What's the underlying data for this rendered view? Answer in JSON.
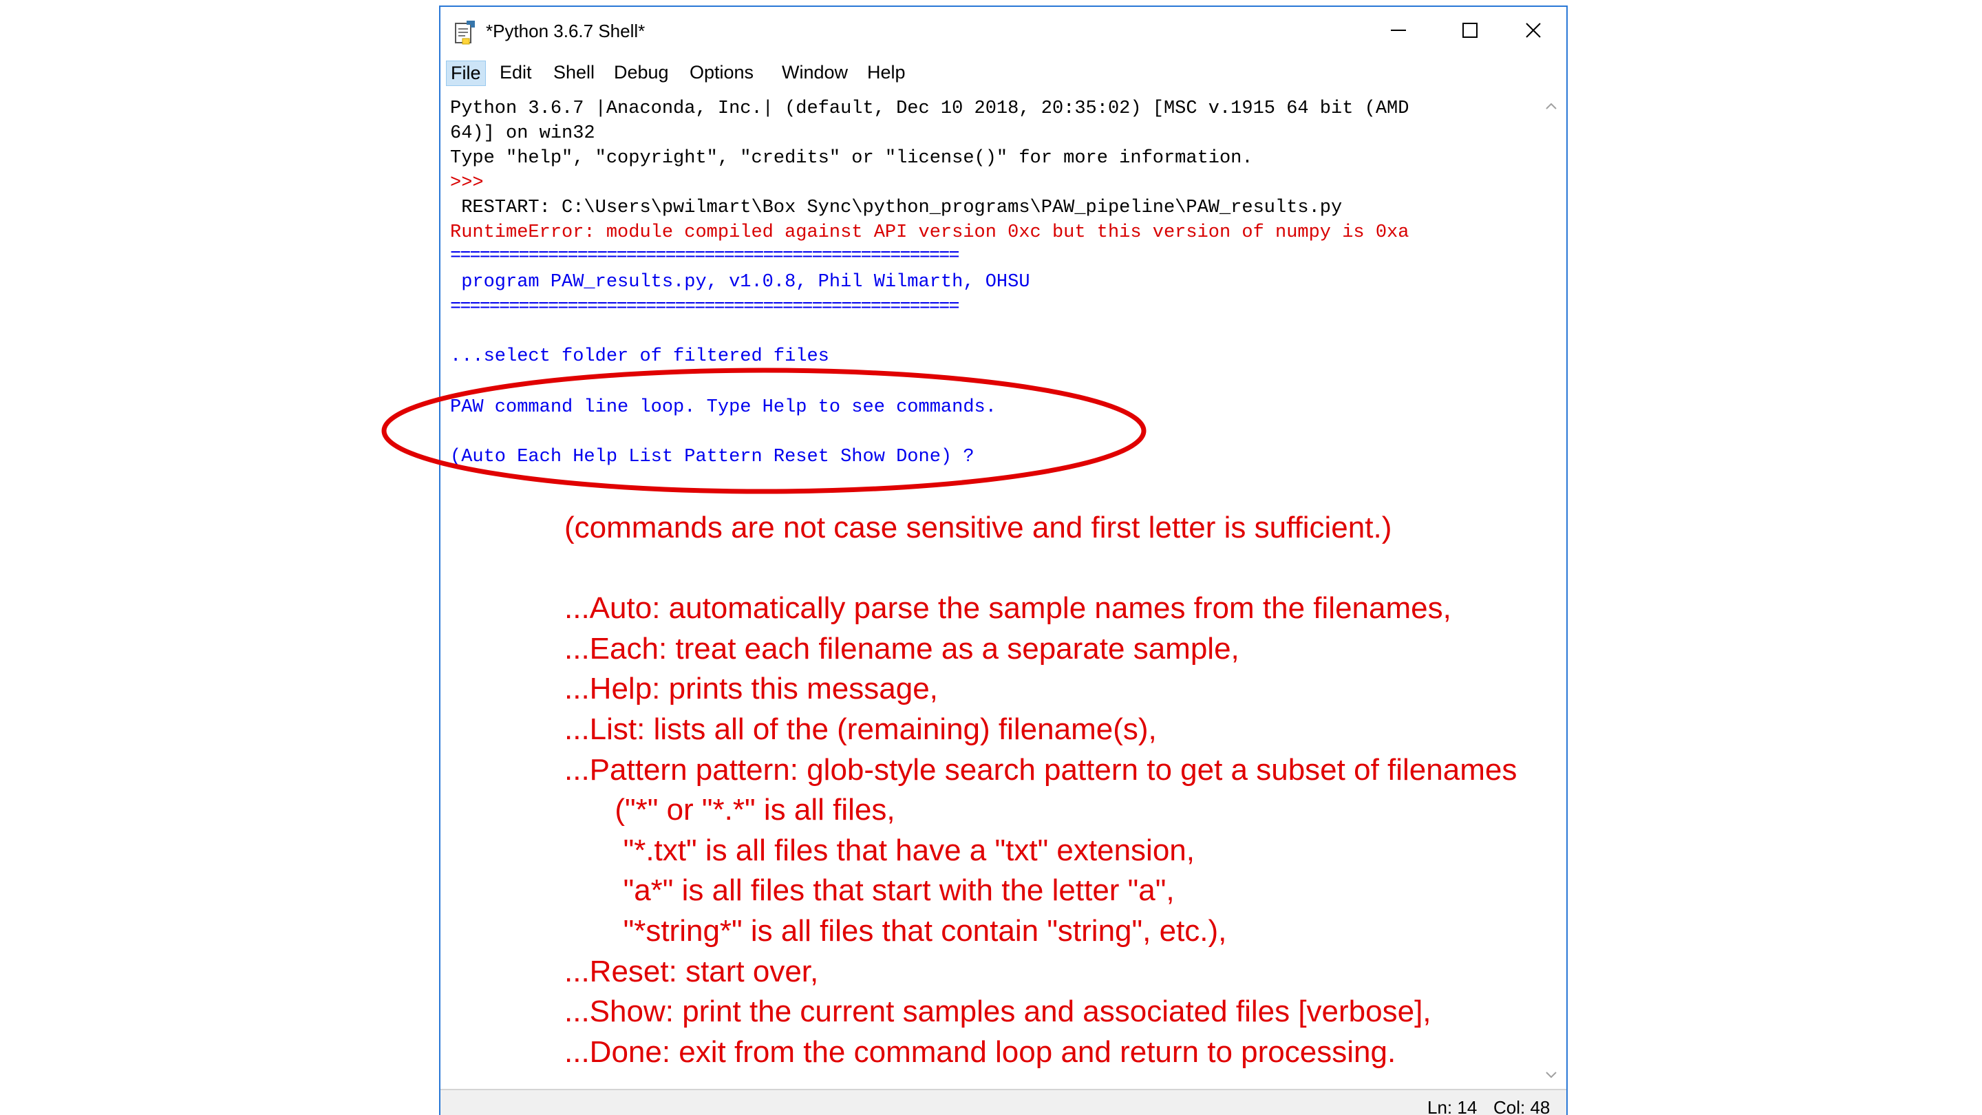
{
  "window": {
    "title": "*Python 3.6.7 Shell*",
    "controls": {
      "minimize_icon": "minimize-icon",
      "maximize_icon": "maximize-icon",
      "close_icon": "close-icon"
    }
  },
  "menu": {
    "items": [
      {
        "label": "File",
        "active": true
      },
      {
        "label": "Edit"
      },
      {
        "label": "Shell"
      },
      {
        "label": "Debug"
      },
      {
        "label": "Options"
      },
      {
        "label": "Window"
      },
      {
        "label": "Help"
      }
    ]
  },
  "shell": {
    "lines": [
      {
        "text": "Python 3.6.7 |Anaconda, Inc.| (default, Dec 10 2018, 20:35:02) [MSC v.1915 64 bit (AMD",
        "color": "black"
      },
      {
        "text": "64)] on win32",
        "color": "black"
      },
      {
        "text": "Type \"help\", \"copyright\", \"credits\" or \"license()\" for more information.",
        "color": "black"
      },
      {
        "text": ">>>",
        "color": "red"
      },
      {
        "text": " RESTART: C:\\Users\\pwilmart\\Box Sync\\python_programs\\PAW_pipeline\\PAW_results.py",
        "color": "black"
      },
      {
        "text": "RuntimeError: module compiled against API version 0xc but this version of numpy is 0xa",
        "color": "red"
      },
      {
        "text": "====================================================",
        "color": "sep"
      },
      {
        "text": " program PAW_results.py, v1.0.8, Phil Wilmarth, OHSU",
        "color": "blue"
      },
      {
        "text": "====================================================",
        "color": "sep"
      },
      {
        "text": "",
        "color": "blue"
      },
      {
        "text": "...select folder of filtered files",
        "color": "blue"
      },
      {
        "text": "",
        "color": "blue"
      },
      {
        "text": "PAW command line loop. Type Help to see commands.",
        "color": "blue"
      },
      {
        "text": "",
        "color": "blue"
      },
      {
        "text": "(Auto Each Help List Pattern Reset Show Done) ?",
        "color": "blue"
      }
    ]
  },
  "status": {
    "ln": "Ln: 14",
    "col": "Col: 48"
  },
  "annotation": {
    "ellipse_color": "#e00000",
    "lines": [
      "(commands are not case sensitive and first letter is sufficient.)",
      "",
      "...Auto: automatically parse the sample names from the filenames,",
      "...Each: treat each filename as a separate sample,",
      "...Help: prints this message,",
      "...List: lists all of the (remaining) filename(s),",
      "...Pattern pattern: glob-style search pattern to get a subset of filenames",
      "      (\"*\" or \"*.*\" is all files,",
      "       \"*.txt\" is all files that have a \"txt\" extension,",
      "       \"a*\" is all files that start with the letter \"a\",",
      "       \"*string*\" is all files that contain \"string\", etc.),",
      "...Reset: start over,",
      "...Show: print the current samples and associated files [verbose],",
      "...Done: exit from the command loop and return to processing."
    ]
  },
  "colors": {
    "black": "#000000",
    "red": "#d80000",
    "blue": "#0000ee",
    "window_border": "#2a78d6",
    "annotation_red": "#e00000"
  }
}
